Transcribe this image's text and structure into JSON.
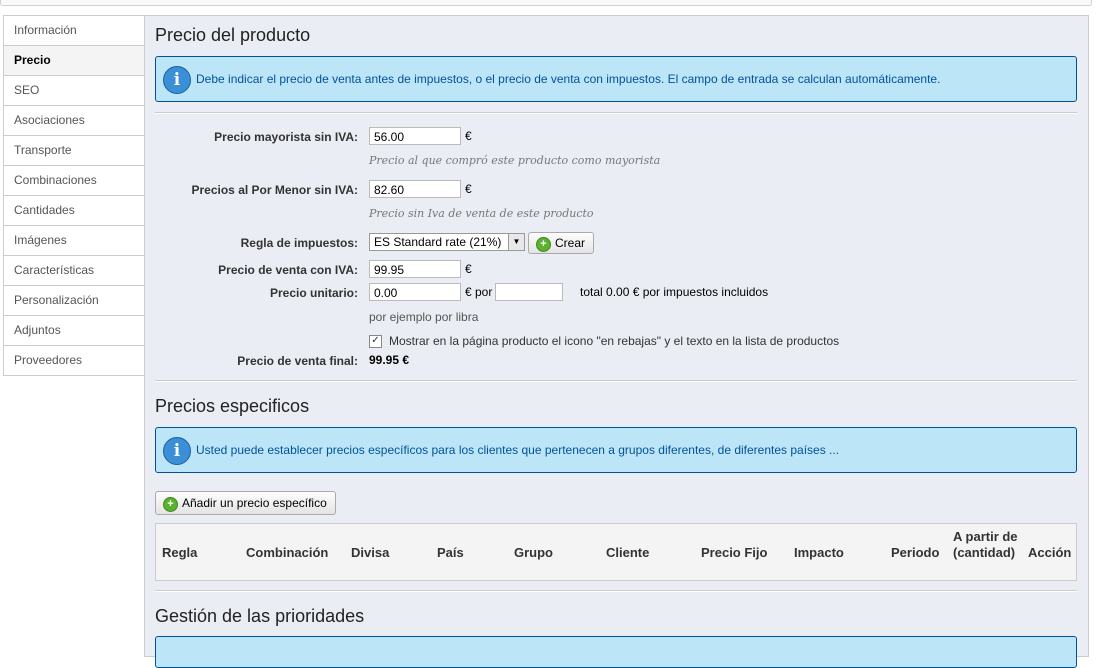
{
  "sidebar": {
    "items": [
      "Información",
      "Precio",
      "SEO",
      "Asociaciones",
      "Transporte",
      "Combinaciones",
      "Cantidades",
      "Imágenes",
      "Características",
      "Personalización",
      "Adjuntos",
      "Proveedores"
    ],
    "active_index": 1
  },
  "price_section": {
    "title": "Precio del producto",
    "info": "Debe indicar el precio de venta antes de impuestos, o el precio de venta con impuestos. El campo de entrada se calculan automáticamente.",
    "wholesale_label": "Precio mayorista sin IVA:",
    "wholesale_value": "56.00",
    "wholesale_hint": "Precio al que compró este producto como mayorista",
    "retail_label": "Precios al Por Menor sin IVA:",
    "retail_value": "82.60",
    "retail_hint": "Precio sin Iva de venta de este producto",
    "tax_rule_label": "Regla de impuestos:",
    "tax_rule_value": "ES Standard rate (21%)",
    "create_button": "Crear",
    "price_with_tax_label": "Precio de venta con IVA:",
    "price_with_tax_value": "99.95",
    "unit_price_label": "Precio unitario:",
    "unit_price_value": "0.00",
    "unit_per": "€ por",
    "unit_per_value": "",
    "unit_total": "total 0.00 € por impuestos incluidos",
    "unit_example": "por ejemplo por libra",
    "on_sale_text": "Mostrar en la página producto el icono \"en rebajas\" y el texto en la lista de productos",
    "on_sale_checked": true,
    "final_price_label": "Precio de venta final:",
    "final_price_value": "99.95 €",
    "currency": "€"
  },
  "specific_section": {
    "title": "Precios especificos",
    "info": "Usted puede establecer precios específicos para los clientes que pertenecen a grupos diferentes, de diferentes países ...",
    "add_button": "Añadir un precio específico",
    "columns": [
      "Regla",
      "Combinación",
      "Divisa",
      "País",
      "Grupo",
      "Cliente",
      "Precio Fijo",
      "Impacto",
      "Periodo",
      "A partir de (cantidad)",
      "Acción"
    ]
  },
  "priority_section": {
    "title": "Gestión de las prioridades"
  }
}
